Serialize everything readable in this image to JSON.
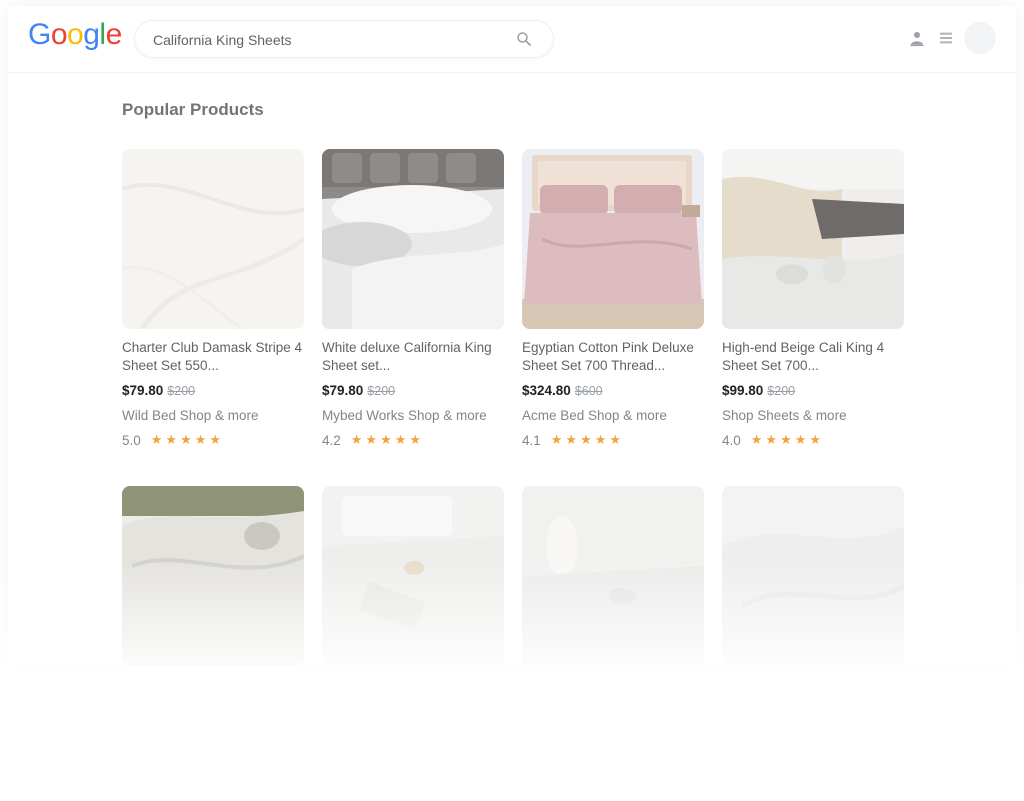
{
  "header": {
    "logo": "Google",
    "search": {
      "value": "California King Sheets",
      "placeholder": ""
    }
  },
  "section_title": "Popular Products",
  "products": [
    {
      "title": "Charter Club Damask Stripe 4 Sheet Set 550...",
      "price": "$79.80",
      "old_price": "$200",
      "shop": "Wild Bed Shop & more",
      "rating": "5.0",
      "stars": "★★★★★"
    },
    {
      "title": "White deluxe California King Sheet set...",
      "price": "$79.80",
      "old_price": "$200",
      "shop": "Mybed Works Shop & more",
      "rating": "4.2",
      "stars": "★★★★★"
    },
    {
      "title": "Egyptian Cotton Pink Deluxe Sheet Set 700 Thread...",
      "price": "$324.80",
      "old_price": "$600",
      "shop": "Acme Bed Shop & more",
      "rating": "4.1",
      "stars": "★★★★★"
    },
    {
      "title": "High-end Beige Cali King 4 Sheet Set 700...",
      "price": "$99.80",
      "old_price": "$200",
      "shop": "Shop Sheets & more",
      "rating": "4.0",
      "stars": "★★★★★"
    }
  ],
  "icons": {
    "search": "search-icon",
    "account": "account-icon",
    "apps": "apps-icon"
  },
  "colors": {
    "star": "#f5a33d",
    "price": "#202124",
    "muted": "#80868b"
  }
}
